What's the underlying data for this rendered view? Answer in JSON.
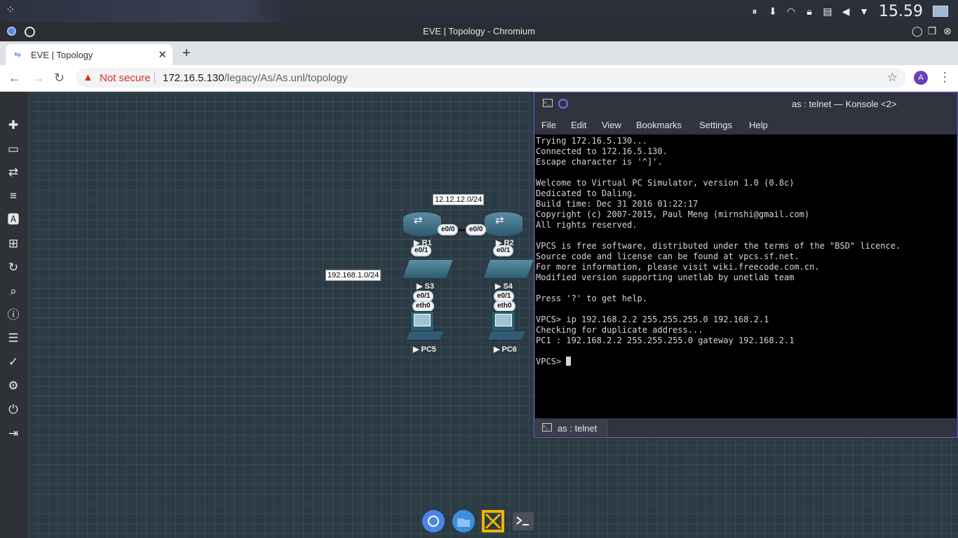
{
  "system_panel": {
    "clock": "15.59",
    "tray_icons": [
      "pause-icon",
      "download-icon",
      "wifi-icon",
      "lock-icon",
      "clipboard-icon",
      "volume-mute-icon",
      "chevron-down-icon",
      "screen-icon"
    ]
  },
  "window": {
    "title": "EVE | Topology - Chromium"
  },
  "browser": {
    "tab_title": "EVE | Topology",
    "security_label": "Not secure",
    "url_host": "172.16.5.130",
    "url_path": "/legacy/As/As.unl/topology",
    "profile_initial": "A"
  },
  "topology": {
    "networks": [
      {
        "label": "12.12.12.0/24"
      },
      {
        "label": "192.168.1.0/24"
      }
    ],
    "nodes": {
      "r1": "R1",
      "r2": "R2",
      "s3": "S3",
      "s4": "S4",
      "pc5": "PC5",
      "pc6": "PC6"
    },
    "interfaces": {
      "r1_e00": "e0/0",
      "r2_e00": "e0/0",
      "r1_e01": "e0/1",
      "r2_e01": "e0/1",
      "s3_e01": "e0/1",
      "s4_e01": "e0/1",
      "pc5_eth0": "eth0",
      "pc6_eth0": "eth0"
    }
  },
  "konsole": {
    "title": "as : telnet — Konsole <2>",
    "menu": [
      "File",
      "Edit",
      "View",
      "Bookmarks",
      "Settings",
      "Help"
    ],
    "lines": [
      "Trying 172.16.5.130...",
      "Connected to 172.16.5.130.",
      "Escape character is '^]'.",
      "",
      "Welcome to Virtual PC Simulator, version 1.0 (0.8c)",
      "Dedicated to Daling.",
      "Build time: Dec 31 2016 01:22:17",
      "Copyright (c) 2007-2015, Paul Meng (mirnshi@gmail.com)",
      "All rights reserved.",
      "",
      "VPCS is free software, distributed under the terms of the \"BSD\" licence.",
      "Source code and license can be found at vpcs.sf.net.",
      "For more information, please visit wiki.freecode.com.cn.",
      "Modified version supporting unetlab by unetlab team",
      "",
      "Press '?' to get help.",
      "",
      "VPCS> ip 192.168.2.2 255.255.255.0 192.168.2.1",
      "Checking for duplicate address...",
      "PC1 : 192.168.2.2 255.255.255.0 gateway 192.168.2.1",
      ""
    ],
    "prompt": "VPCS> ",
    "tab_label": "as : telnet"
  },
  "eve_sidebar": [
    "add-icon",
    "nodes-icon",
    "networks-icon",
    "startup-configs-icon",
    "text-icon",
    "grid-icon",
    "refresh-icon",
    "zoom-icon",
    "info-icon",
    "list-icon",
    "check-icon",
    "settings-icon",
    "power-icon",
    "logout-icon"
  ]
}
